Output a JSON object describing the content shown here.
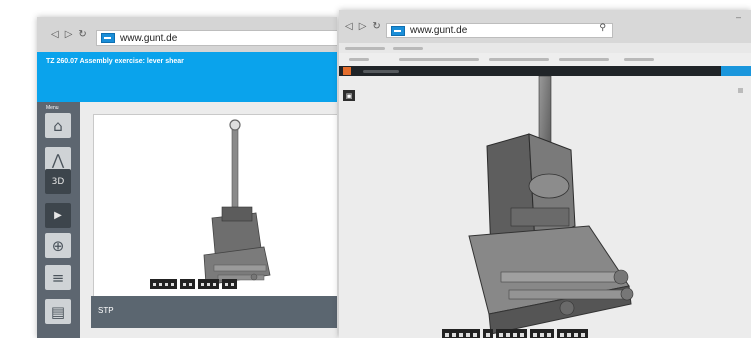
{
  "left_window": {
    "url": "www.gunt.de",
    "app_title": "TZ 260.07 Assembly exercise: lever shear",
    "menu_label": "Menu",
    "sidebar": [
      {
        "icon": "home-icon",
        "glyph": "⌂"
      },
      {
        "icon": "compass-icon",
        "glyph": "⋀"
      },
      {
        "icon": "3d-icon",
        "glyph": "3D"
      },
      {
        "icon": "play-icon",
        "glyph": "▶"
      },
      {
        "icon": "key-icon",
        "glyph": "⊕"
      },
      {
        "icon": "document-icon",
        "glyph": "≡"
      },
      {
        "icon": "book-icon",
        "glyph": "▤"
      }
    ],
    "caption": "STP",
    "toolbar_groups": [
      4,
      2,
      3,
      2
    ]
  },
  "right_window": {
    "url": "www.gunt.de",
    "toolbar_groups": [
      5,
      1,
      4,
      3,
      4
    ]
  },
  "colors": {
    "accent_blue": "#0aa3ec",
    "sidebar_gray": "#5d6670",
    "model_gray": "#6f6f6f"
  }
}
